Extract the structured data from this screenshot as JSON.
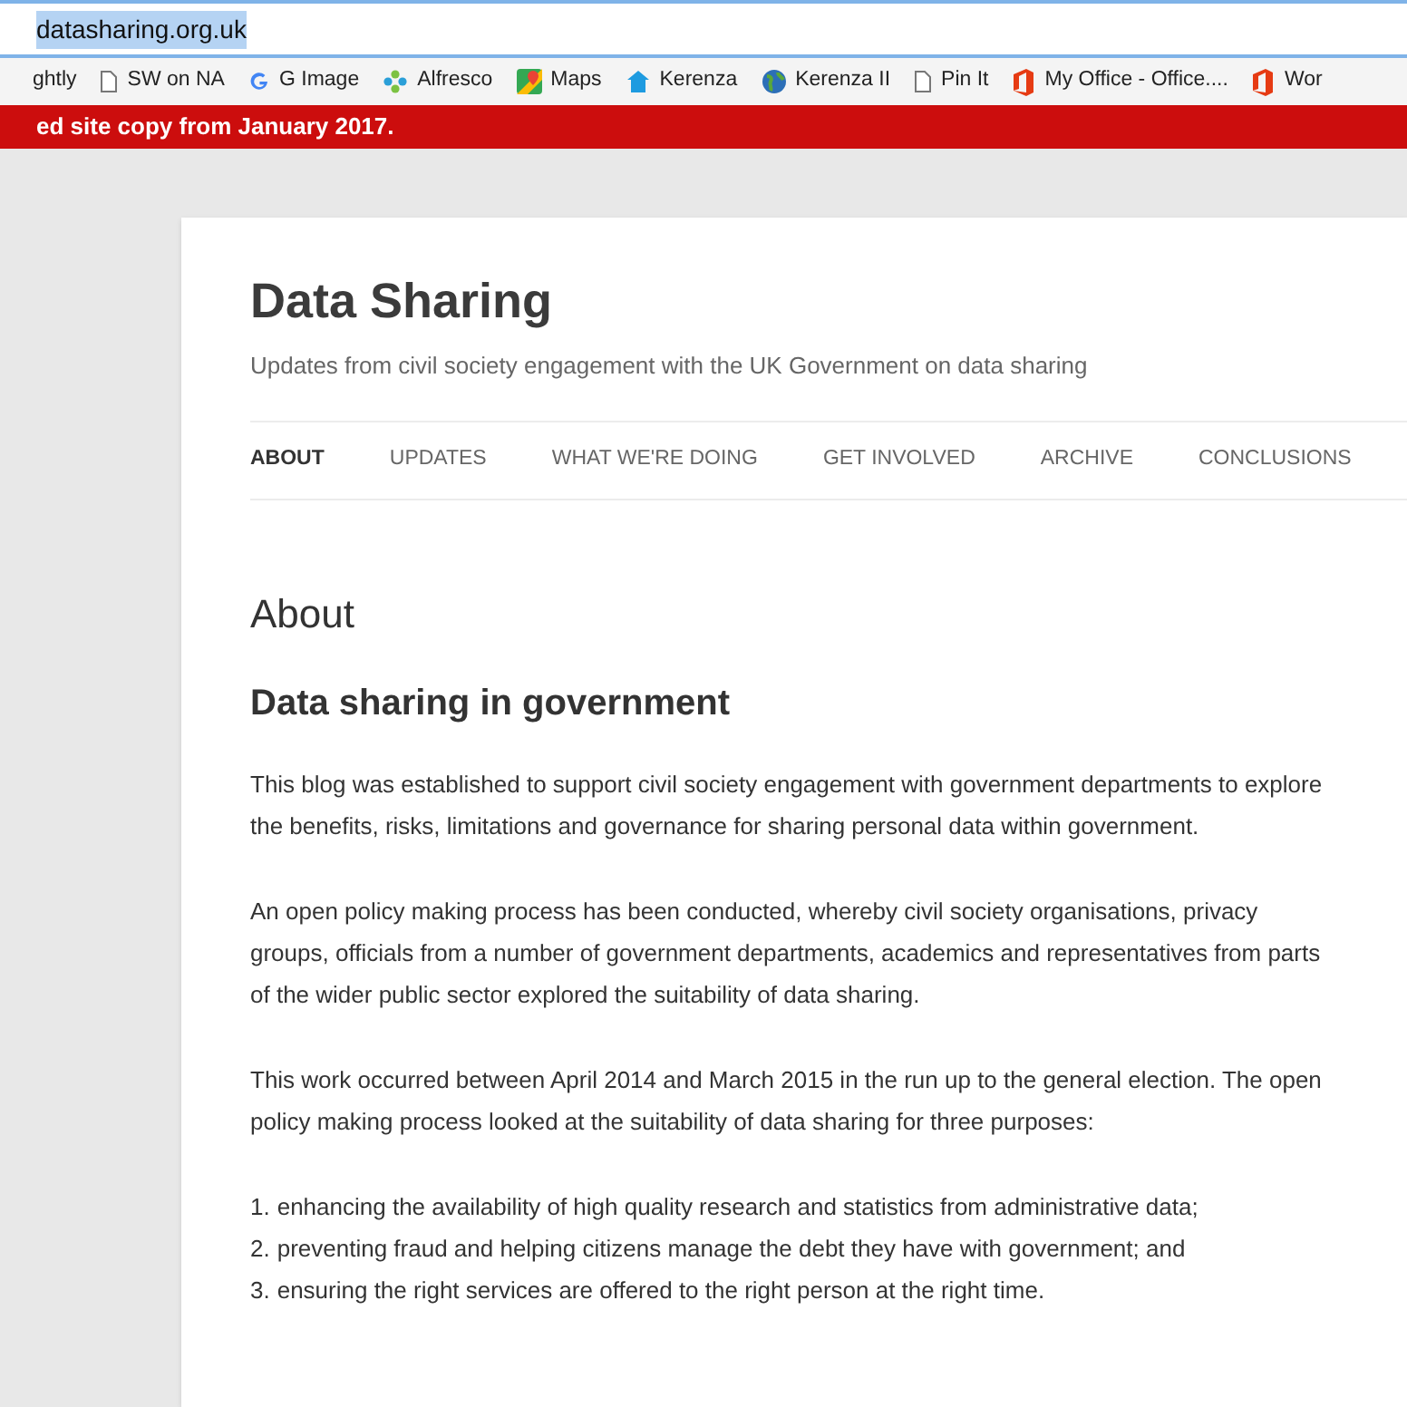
{
  "address_bar": {
    "url": "datasharing.org.uk"
  },
  "bookmarks": [
    {
      "label": "ghtly",
      "kind": "none"
    },
    {
      "label": "SW on NA",
      "kind": "page"
    },
    {
      "label": "G Image",
      "kind": "google"
    },
    {
      "label": "Alfresco",
      "kind": "flower"
    },
    {
      "label": "Maps",
      "kind": "map"
    },
    {
      "label": "Kerenza",
      "kind": "house"
    },
    {
      "label": "Kerenza II",
      "kind": "globe"
    },
    {
      "label": "Pin It",
      "kind": "page"
    },
    {
      "label": "My Office - Office....",
      "kind": "office"
    },
    {
      "label": "Wor",
      "kind": "office"
    }
  ],
  "banner": {
    "text": "ed site copy from January 2017."
  },
  "site": {
    "title": "Data Sharing",
    "tagline": "Updates from civil society engagement with the UK Government on data sharing"
  },
  "nav": [
    {
      "label": "ABOUT",
      "selected": true
    },
    {
      "label": "UPDATES",
      "selected": false
    },
    {
      "label": "WHAT WE'RE DOING",
      "selected": false
    },
    {
      "label": "GET INVOLVED",
      "selected": false
    },
    {
      "label": "ARCHIVE",
      "selected": false
    },
    {
      "label": "CONCLUSIONS",
      "selected": false
    }
  ],
  "page": {
    "title": "About",
    "heading": "Data sharing in government",
    "paragraphs": [
      "This blog was established to support civil society engagement with government departments to explore the benefits, risks, limitations and governance for sharing personal data within government.",
      "An open policy making process has been conducted, whereby civil society organisations, privacy groups, officials from a number of government departments, academics and representatives from parts of the wider public sector explored the suitability of data sharing.",
      "This work occurred between April 2014 and March 2015 in the run up to the general election. The open policy making process looked at the suitability of data sharing for three purposes:"
    ],
    "list": [
      {
        "number": "1.",
        "text": "enhancing the availability of high quality research and statistics from administrative data;"
      },
      {
        "number": "2.",
        "text": "preventing fraud and helping citizens manage the debt they have with government; and"
      },
      {
        "number": "3.",
        "text": "ensuring the right services are offered to the right person at the right time."
      }
    ]
  }
}
